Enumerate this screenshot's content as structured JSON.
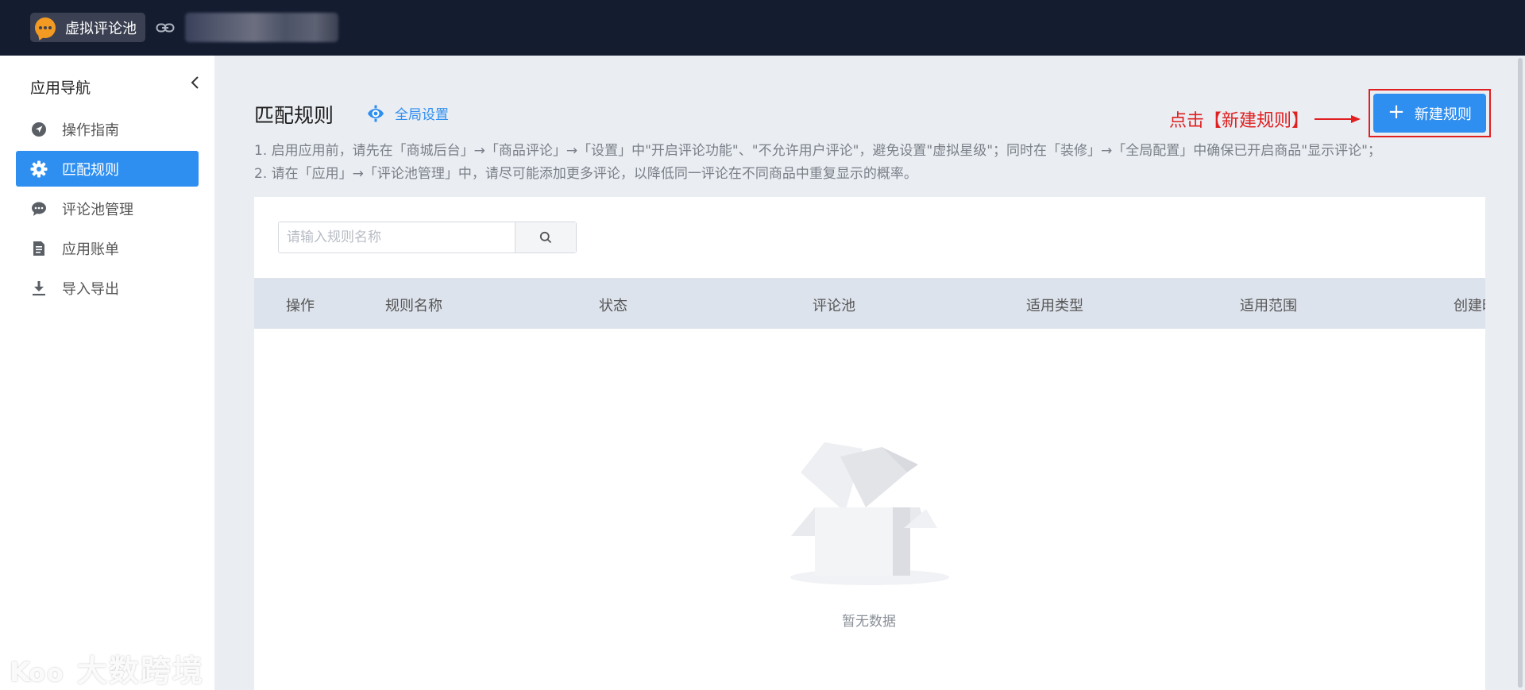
{
  "topbar": {
    "app_title": "虚拟评论池",
    "icons": {
      "app_logo": "chat-bubble-icon",
      "link": "link-icon"
    }
  },
  "sidebar": {
    "title": "应用导航",
    "items": [
      {
        "label": "操作指南",
        "icon": "navigation-arrow-icon",
        "active": false
      },
      {
        "label": "匹配规则",
        "icon": "gear-icon",
        "active": true
      },
      {
        "label": "评论池管理",
        "icon": "comment-icon",
        "active": false
      },
      {
        "label": "应用账单",
        "icon": "bill-icon",
        "active": false
      },
      {
        "label": "导入导出",
        "icon": "download-icon",
        "active": false
      }
    ],
    "watermark": "大数跨境"
  },
  "main": {
    "page_title": "匹配规则",
    "global_settings": "全局设置",
    "annotation": "点击【新建规则】",
    "new_rule_button": "新建规则",
    "tips": [
      "1. 启用应用前，请先在「商城后台」→「商品评论」→「设置」中\"开启评论功能\"、\"不允许用户评论\"，避免设置\"虚拟星级\"；同时在「装修」→「全局配置」中确保已开启商品\"显示评论\"；",
      "2. 请在「应用」→「评论池管理」中，请尽可能添加更多评论，以降低同一评论在不同商品中重复显示的概率。"
    ],
    "search": {
      "placeholder": "请输入规则名称",
      "value": ""
    },
    "table": {
      "columns": [
        "操作",
        "规则名称",
        "状态",
        "评论池",
        "适用类型",
        "适用范围",
        "创建时"
      ],
      "rows": []
    },
    "empty_text": "暂无数据"
  },
  "colors": {
    "topbar": "#141c30",
    "accent": "#2f8ff0",
    "annotation": "#e02020",
    "background": "#eaedf2"
  }
}
